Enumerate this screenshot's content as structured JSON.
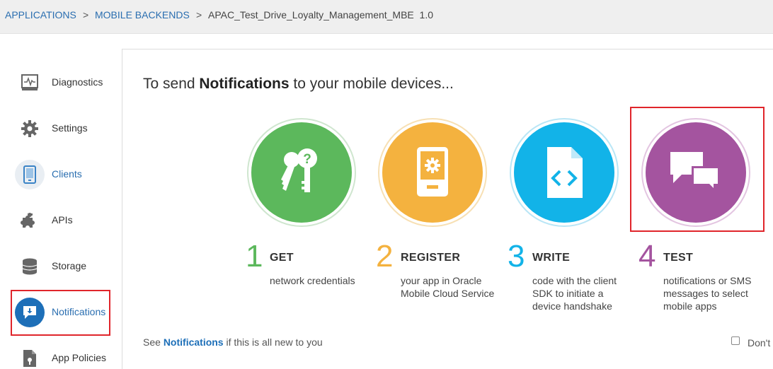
{
  "breadcrumb": {
    "applications": "APPLICATIONS",
    "sep1": ">",
    "mobile_backends": "MOBILE BACKENDS",
    "sep2": ">",
    "current": "APAC_Test_Drive_Loyalty_Management_MBE  1.0"
  },
  "sidebar": {
    "items": [
      {
        "label": "Diagnostics",
        "icon": "diagnostics-icon"
      },
      {
        "label": "Settings",
        "icon": "gear-icon"
      },
      {
        "label": "Clients",
        "icon": "mobile-device-icon"
      },
      {
        "label": "APIs",
        "icon": "puzzle-icon"
      },
      {
        "label": "Storage",
        "icon": "database-icon"
      },
      {
        "label": "Notifications",
        "icon": "notification-icon"
      },
      {
        "label": "App Policies",
        "icon": "policy-document-icon"
      }
    ]
  },
  "main": {
    "headline_prefix": "To send ",
    "headline_bold": "Notifications",
    "headline_suffix": " to your mobile devices...",
    "steps": [
      {
        "number": "1",
        "title": "GET",
        "description": "network credentials",
        "color": "#5cb85c",
        "icon": "keys-icon"
      },
      {
        "number": "2",
        "title": "REGISTER",
        "description": "your app in Oracle Mobile Cloud Service",
        "color": "#f4b23f",
        "icon": "mobile-app-settings-icon"
      },
      {
        "number": "3",
        "title": "WRITE",
        "description": "code with the client SDK to initiate a device handshake",
        "color": "#12b3e8",
        "icon": "code-file-icon"
      },
      {
        "number": "4",
        "title": "TEST",
        "description": "notifications or SMS messages to select mobile apps",
        "color": "#a4549f",
        "icon": "chat-bubbles-icon"
      }
    ],
    "footer_prefix": "See ",
    "footer_link": "Notifications",
    "footer_suffix": " if this is all new to you",
    "dont_show_label": "Don't"
  },
  "colors": {
    "accent_blue": "#1d6fb8",
    "highlight_red": "#e0252b",
    "breadcrumb_bg": "#efefef"
  }
}
